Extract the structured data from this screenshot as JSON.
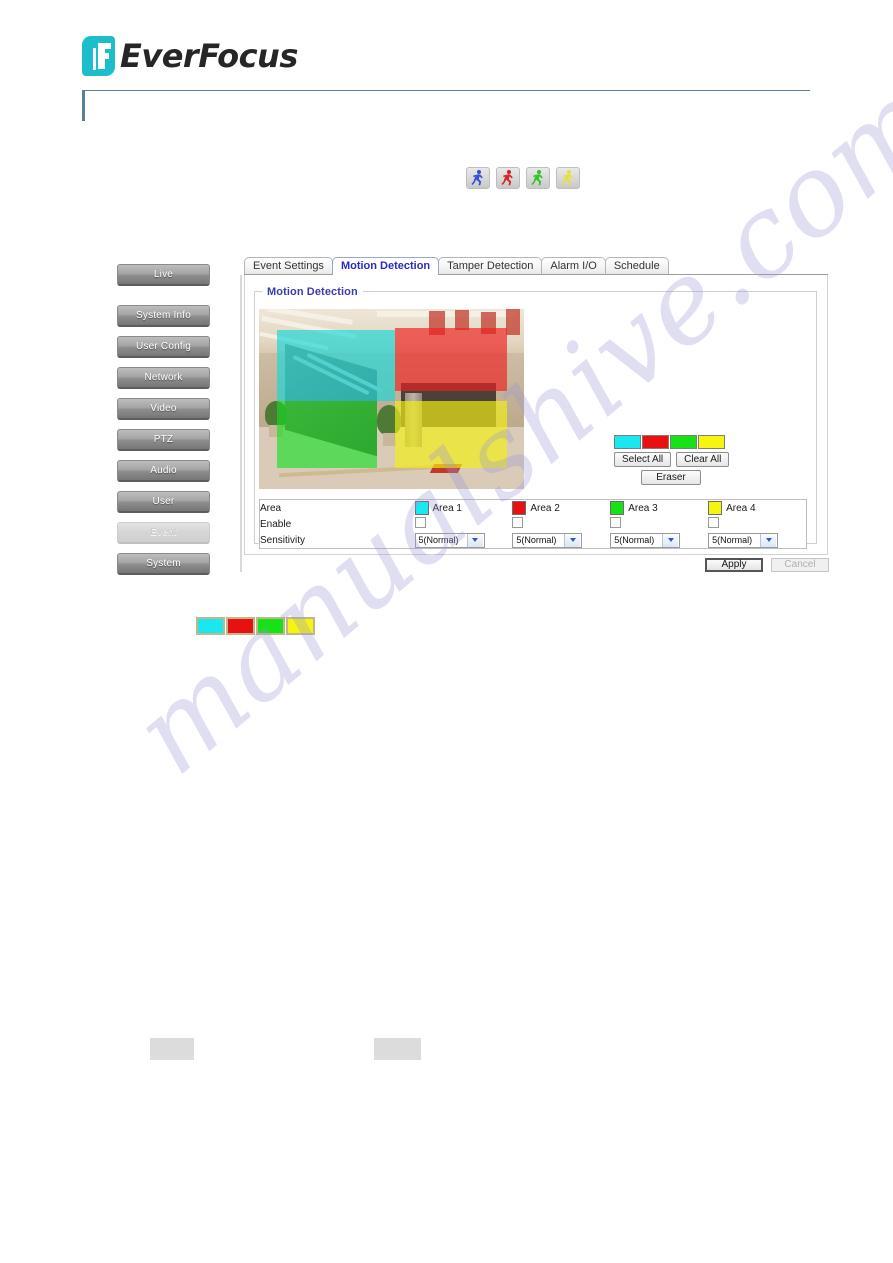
{
  "brand": {
    "name": "EverFocus",
    "logo_icon": "everfocus-f-logo-icon",
    "logo_color": "#1dbecb"
  },
  "motion_icon_strip": {
    "icons": [
      {
        "name": "motion-person-blue-icon",
        "color": "#3b4fd6"
      },
      {
        "name": "motion-person-red-icon",
        "color": "#d6252b"
      },
      {
        "name": "motion-person-green-icon",
        "color": "#35c22f"
      },
      {
        "name": "motion-person-yellow-icon",
        "color": "#e8e03a"
      }
    ]
  },
  "sidebar": {
    "items": [
      {
        "label": "Live",
        "active": false
      },
      {
        "label": "System Info",
        "active": false
      },
      {
        "label": "User Config",
        "active": false
      },
      {
        "label": "Network",
        "active": false
      },
      {
        "label": "Video",
        "active": false
      },
      {
        "label": "PTZ",
        "active": false
      },
      {
        "label": "Audio",
        "active": false
      },
      {
        "label": "User",
        "active": false
      },
      {
        "label": "Event",
        "active": true
      },
      {
        "label": "System",
        "active": false
      }
    ]
  },
  "tabs": [
    {
      "label": "Event Settings",
      "active": false
    },
    {
      "label": "Motion Detection",
      "active": true
    },
    {
      "label": "Tamper Detection",
      "active": false
    },
    {
      "label": "Alarm I/O",
      "active": false
    },
    {
      "label": "Schedule",
      "active": false
    }
  ],
  "panel": {
    "legend": "Motion Detection"
  },
  "preview": {
    "regions": [
      {
        "name": "area-1-region",
        "color": "#15d8d8"
      },
      {
        "name": "area-2-region",
        "color": "#ef1f1f"
      },
      {
        "name": "area-3-region",
        "color": "#12e020"
      },
      {
        "name": "area-4-region",
        "color": "#f2ef14"
      }
    ]
  },
  "palette": {
    "swatches": [
      {
        "name": "palette-swatch-cyan",
        "color": "#1ae8f0"
      },
      {
        "name": "palette-swatch-red",
        "color": "#e81010"
      },
      {
        "name": "palette-swatch-green",
        "color": "#17e117"
      },
      {
        "name": "palette-swatch-yellow",
        "color": "#f5f510"
      }
    ],
    "select_all_label": "Select All",
    "clear_all_label": "Clear All",
    "eraser_label": "Eraser"
  },
  "area_table": {
    "row_labels": {
      "area": "Area",
      "enable": "Enable",
      "sensitivity": "Sensitivity"
    },
    "columns": [
      {
        "area_label": "Area 1",
        "color": "#1ae8f0",
        "enabled": false,
        "sensitivity": "5(Normal)"
      },
      {
        "area_label": "Area 2",
        "color": "#e81010",
        "enabled": false,
        "sensitivity": "5(Normal)"
      },
      {
        "area_label": "Area 3",
        "color": "#17e117",
        "enabled": false,
        "sensitivity": "5(Normal)"
      },
      {
        "area_label": "Area 4",
        "color": "#f5f510",
        "enabled": false,
        "sensitivity": "5(Normal)"
      }
    ]
  },
  "actions": {
    "apply_label": "Apply",
    "cancel_label": "Cancel",
    "cancel_disabled": true
  },
  "legend_swatches": [
    {
      "name": "legend-swatch-cyan",
      "color": "#1ae8f0"
    },
    {
      "name": "legend-swatch-red",
      "color": "#e81010"
    },
    {
      "name": "legend-swatch-green",
      "color": "#17e117"
    },
    {
      "name": "legend-swatch-yellow",
      "color": "#f5f510"
    }
  ],
  "watermark": {
    "text": "manualshive.com"
  }
}
